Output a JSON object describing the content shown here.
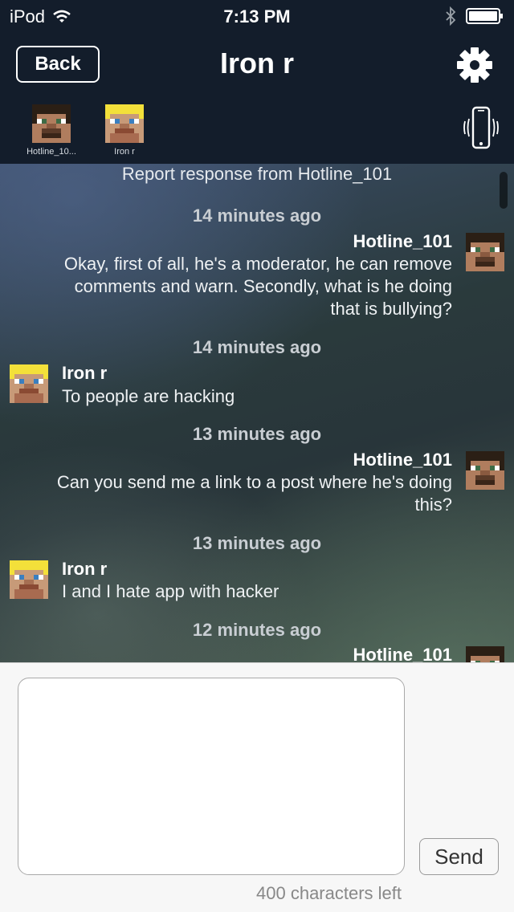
{
  "status_bar": {
    "carrier": "iPod",
    "time": "7:13 PM"
  },
  "nav": {
    "back_label": "Back",
    "title": "Iron r"
  },
  "participants": [
    {
      "name": "Hotline_10...",
      "avatar": "steve-avatar-icon"
    },
    {
      "name": "Iron r",
      "avatar": "blond-avatar-icon"
    }
  ],
  "chat": {
    "report_line": "Report response from Hotline_101",
    "messages": [
      {
        "time": "14 minutes ago",
        "sender": "Hotline_101",
        "side": "right",
        "lines": [
          "Okay, first of all, he's a moderator, he can remove",
          "comments and warn. Secondly, what is he doing",
          "that is bullying?"
        ]
      },
      {
        "time": "14 minutes ago",
        "sender": "Iron r",
        "side": "left",
        "lines": [
          "To people are hacking"
        ]
      },
      {
        "time": "13 minutes ago",
        "sender": "Hotline_101",
        "side": "right",
        "lines": [
          "Can you send me a link to a post where he's doing",
          "this?"
        ]
      },
      {
        "time": "13 minutes ago",
        "sender": "Iron r",
        "side": "left",
        "lines": [
          "I and I hate app with hacker"
        ]
      },
      {
        "time": "12 minutes ago",
        "sender": "Hotline_101",
        "side": "right",
        "lines": []
      }
    ]
  },
  "composer": {
    "input_value": "",
    "send_label": "Send",
    "chars_left": "400 characters left"
  },
  "colors": {
    "nav_bg": "#131d2b",
    "composer_bg": "#f7f7f7",
    "text_light": "#ffffff"
  }
}
